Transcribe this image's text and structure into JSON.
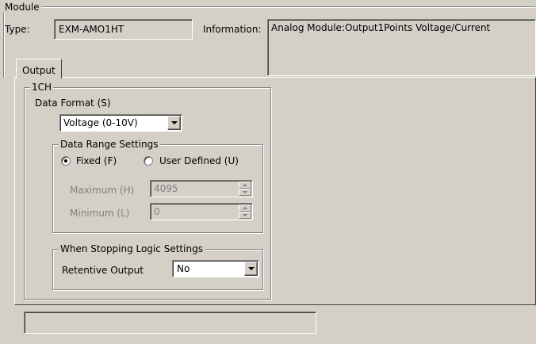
{
  "module": {
    "group_label": "Module",
    "type_label": "Type:",
    "type_value": "EXM-AMO1HT",
    "information_label": "Information:",
    "information_value": "Analog Module:Output1Points Voltage/Current"
  },
  "tabs": [
    {
      "label": "Output",
      "selected": true
    }
  ],
  "channel": {
    "group_label": "1CH",
    "data_format_label": "Data Format (S)",
    "data_format_value": "Voltage (0-10V)",
    "range": {
      "group_label": "Data Range Settings",
      "fixed_label": "Fixed (F)",
      "user_defined_label": "User Defined (U)",
      "selected": "fixed",
      "maximum_label": "Maximum (H)",
      "maximum_value": "4095",
      "minimum_label": "Minimum (L)",
      "minimum_value": "0"
    },
    "stopping": {
      "group_label": "When Stopping Logic Settings",
      "retentive_label": "Retentive Output",
      "retentive_value": "No"
    }
  },
  "status_field": ""
}
